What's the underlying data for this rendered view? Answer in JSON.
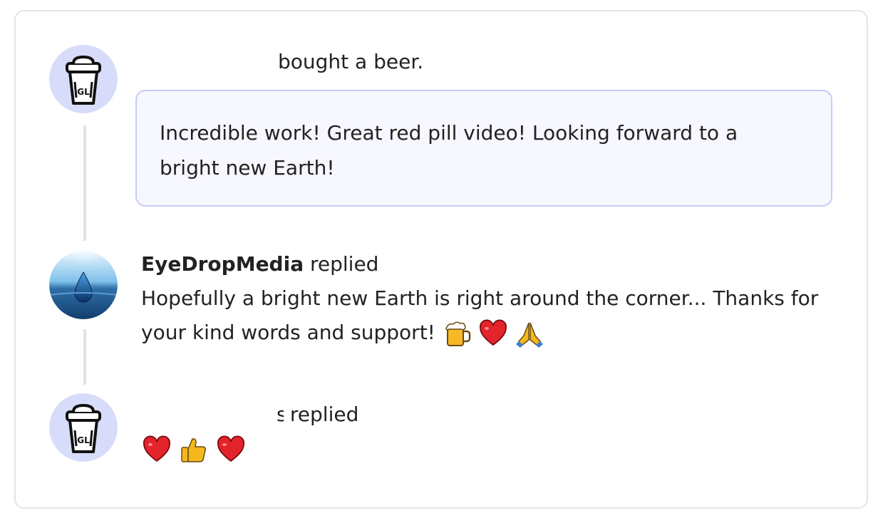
{
  "supporter": {
    "avatar_icon": "coffee-cup-icon",
    "avatar_text": "GL",
    "action": "bought a beer.",
    "message": "Incredible work! Great red pill video! Looking forward to a bright new Earth!"
  },
  "creator_reply": {
    "avatar_icon": "water-drop-avatar-icon",
    "author": "EyeDropMedia",
    "verb": "replied",
    "text": "Hopefully a bright new Earth is right around the corner... Thanks for your kind words and support!",
    "emojis": [
      "beer-mug-icon",
      "red-heart-icon",
      "folded-hands-icon"
    ]
  },
  "supporter_reply": {
    "avatar_icon": "coffee-cup-icon",
    "avatar_text": "GL",
    "author_tail": "s",
    "verb": "replied",
    "emojis": [
      "red-heart-icon",
      "thumbs-up-icon",
      "red-heart-icon"
    ]
  },
  "colors": {
    "avatar_bg": "#d8dcfb",
    "message_bg": "#f6f7ff",
    "message_border": "#c5cdf8",
    "thread_line": "#e2e2e2",
    "heart": "#e3242b",
    "thumbs": "#f4b81c"
  }
}
